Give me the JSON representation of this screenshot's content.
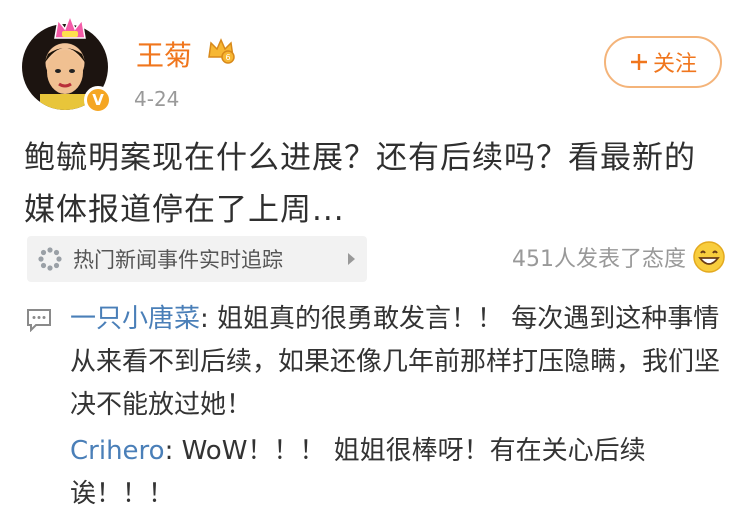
{
  "post": {
    "username": "王菊",
    "date": "4-24",
    "follow_label": "关注",
    "text": "鲍毓明案现在什么进展？还有后续吗？看最新的媒体报道停在了上周...",
    "verified_badge": "V"
  },
  "topic": {
    "label": "热门新闻事件实时追踪"
  },
  "reactions": {
    "count_text": "451人发表了态度",
    "icon": "grinning-face-icon"
  },
  "comments": [
    {
      "author": "一只小唐菜",
      "text": ": 姐姐真的很勇敢发言！！ 每次遇到这种事情从来看不到后续，如果还像几年前那样打压隐瞒，我们坚决不能放过她！"
    },
    {
      "author": "Crihero",
      "text": ": WoW！！！ 姐姐很棒呀！有在关心后续诶！！！"
    }
  ],
  "colors": {
    "accent_orange": "#f0761d",
    "link_blue": "#4a7fb8",
    "muted_gray": "#999999"
  }
}
